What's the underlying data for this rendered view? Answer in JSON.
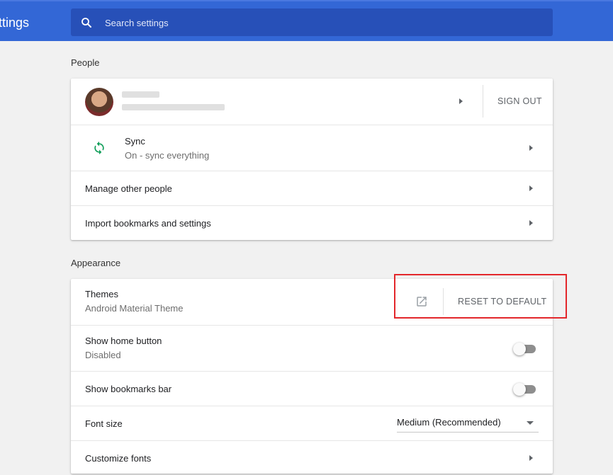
{
  "header": {
    "title": "ttings",
    "search_placeholder": "Search settings"
  },
  "people": {
    "section_title": "People",
    "sign_out_label": "SIGN OUT",
    "sync": {
      "label": "Sync",
      "status": "On - sync everything"
    },
    "manage_label": "Manage other people",
    "import_label": "Import bookmarks and settings"
  },
  "appearance": {
    "section_title": "Appearance",
    "themes": {
      "label": "Themes",
      "value": "Android Material Theme",
      "reset_label": "RESET TO DEFAULT"
    },
    "home_button": {
      "label": "Show home button",
      "status": "Disabled",
      "enabled": false
    },
    "bookmarks_bar": {
      "label": "Show bookmarks bar",
      "enabled": false
    },
    "font_size": {
      "label": "Font size",
      "selected": "Medium (Recommended)"
    },
    "custom_fonts_label": "Customize fonts"
  },
  "colors": {
    "header_blue": "#3367d6",
    "search_blue": "#2750b8",
    "sync_green": "#0f9d58",
    "highlight_red": "#e3272b"
  },
  "icons": [
    "search-icon",
    "sync-icon",
    "open-external-icon",
    "chevron-right-icon",
    "dropdown-caret-icon"
  ]
}
